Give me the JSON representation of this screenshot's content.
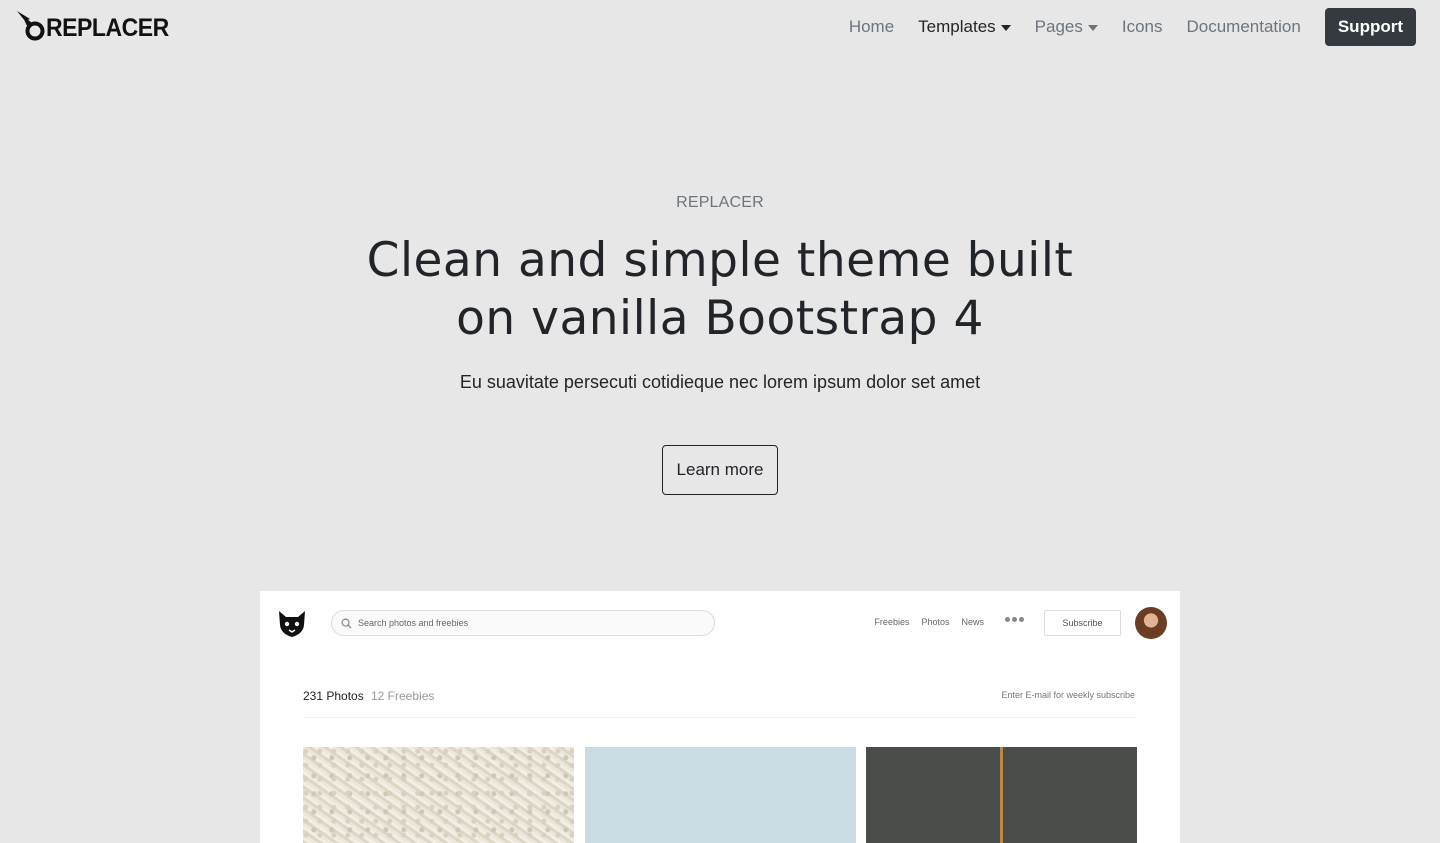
{
  "navbar": {
    "brand": "REPLACER",
    "links": [
      {
        "label": "Home"
      },
      {
        "label": "Templates"
      },
      {
        "label": "Pages"
      },
      {
        "label": "Icons"
      },
      {
        "label": "Documentation"
      }
    ],
    "support_label": "Support"
  },
  "hero": {
    "eyebrow": "REPLACER",
    "title_line1": "Clean and simple theme built",
    "title_line2": "on vanilla Bootstrap 4",
    "lead": "Eu suavitate persecuti cotidieque nec lorem ipsum dolor set amet",
    "cta_label": "Learn more"
  },
  "preview": {
    "search_placeholder": "Search photos and freebies",
    "nav": [
      "Freebies",
      "Photos",
      "News"
    ],
    "subscribe_label": "Subscribe",
    "photos_count": "231 Photos",
    "freebies_count": "12 Freebies",
    "email_prompt": "Enter E-mail for weekly subscribe"
  },
  "colors": {
    "page_bg": "#e7e7e7",
    "support_bg": "#343a40",
    "text_muted": "#6c757d"
  }
}
